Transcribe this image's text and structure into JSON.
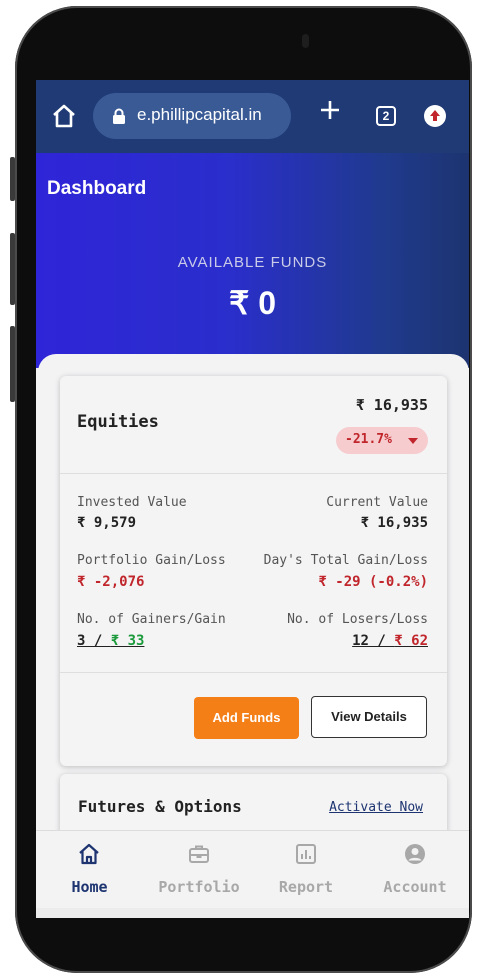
{
  "browser": {
    "url": "e.phillipcapital.in",
    "tab_count": "2"
  },
  "hero": {
    "title": "Dashboard",
    "available_funds_label": "AVAILABLE FUNDS",
    "available_funds_value": "₹ 0"
  },
  "equities": {
    "title": "Equities",
    "value": "₹ 16,935",
    "change_pct": "-21.7%",
    "invested_label": "Invested Value",
    "invested_value": "₹ 9,579",
    "current_label": "Current Value",
    "current_value": "₹ 16,935",
    "portfolio_gl_label": "Portfolio Gain/Loss",
    "portfolio_gl_value": "₹ -2,076",
    "day_gl_label": "Day's Total Gain/Loss",
    "day_gl_value": "₹ -29 (-0.2%)",
    "gainers_label": "No. of Gainers/Gain",
    "gainers_count": "3 / ",
    "gainers_gain": "₹ 33",
    "losers_label": "No. of Losers/Loss",
    "losers_count": "12 / ",
    "losers_loss": "₹ 62",
    "add_funds_label": "Add Funds",
    "view_details_label": "View Details"
  },
  "fo": {
    "title": "Futures & Options",
    "activate_label": "Activate Now"
  },
  "nav": {
    "items": [
      {
        "label": "Home",
        "icon": "home-icon",
        "active": true
      },
      {
        "label": "Portfolio",
        "icon": "briefcase-icon",
        "active": false
      },
      {
        "label": "Report",
        "icon": "report-icon",
        "active": false
      },
      {
        "label": "Account",
        "icon": "account-icon",
        "active": false
      }
    ]
  },
  "colors": {
    "accent": "#f57f17",
    "hero_start": "#2f25d8",
    "hero_end": "#1d3470",
    "negative": "#c0262b",
    "positive": "#1a9a3a"
  }
}
